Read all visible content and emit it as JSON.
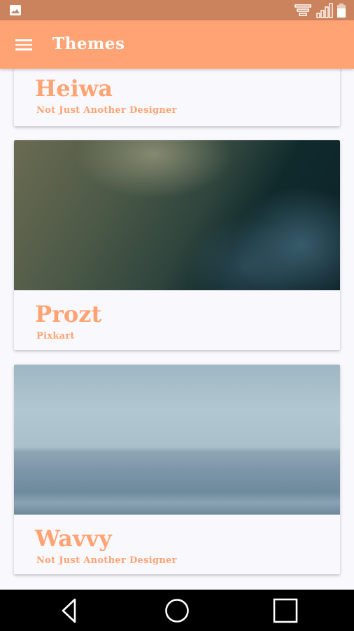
{
  "status_bar": {
    "left_icons": [
      "image-notification-icon"
    ],
    "right_icons": [
      "wifi-icon",
      "signal-icon",
      "battery-icon"
    ]
  },
  "app_bar": {
    "title": "Themes",
    "menu_icon": "hamburger-menu-icon"
  },
  "themes": [
    {
      "name": "Heiwa",
      "author": "Not Just Another Designer",
      "image": "none-visible"
    },
    {
      "name": "Prozt",
      "author": "Pixkart",
      "image": "dark mossy rock"
    },
    {
      "name": "Wavvy",
      "author": "Not Just Another Designer",
      "image": "foggy sea waves"
    }
  ],
  "nav_bar": {
    "back": "back-icon",
    "home": "home-icon",
    "recents": "recents-icon"
  },
  "colors": {
    "status_bar": "#cb835e",
    "app_bar": "#ffa375",
    "accent_text": "#ffa372",
    "background": "#f8f8fd"
  }
}
